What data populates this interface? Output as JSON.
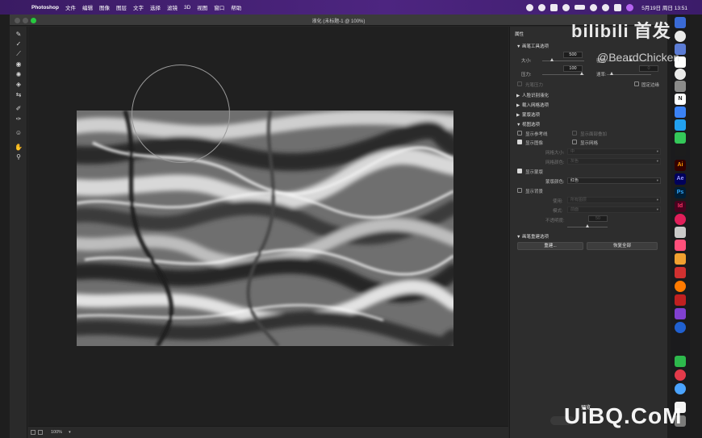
{
  "menubar": {
    "app_name": "Photoshop",
    "items": [
      "文件",
      "编辑",
      "图像",
      "图层",
      "文字",
      "选择",
      "滤镜",
      "3D",
      "视图",
      "窗口",
      "帮助"
    ],
    "datetime": "5月19日 周日 13:51"
  },
  "window": {
    "title": "液化 (未标题-1 @ 100%)"
  },
  "status": {
    "zoom": "100%"
  },
  "panel": {
    "title": "属性",
    "brush_section": "画笔工具选项",
    "size_label": "大小:",
    "size_value": "500",
    "density_label": "密度:",
    "pressure_label": "压力:",
    "pressure_value": "100",
    "rate_label": "速率:",
    "rate_value": "0",
    "stylus_label": "光笔压力",
    "pin_edges_label": "固定边缘",
    "face_aware": "人脸识别液化",
    "load_mesh": "载入网格选项",
    "mask_options": "蒙版选项",
    "view_options": "视图选项",
    "show_guides": "显示参考线",
    "show_face_overlay": "显示面部叠加",
    "show_image": "显示图像",
    "show_mesh": "显示网格",
    "mesh_size_label": "网格大小:",
    "mesh_size_value": "中",
    "mesh_color_label": "网格颜色:",
    "mesh_color_value": "灰色",
    "show_mask": "显示蒙版",
    "mask_color_label": "蒙版颜色:",
    "mask_color_value": "红色",
    "show_backdrop": "显示背景",
    "use_label": "使用:",
    "use_value": "所有图层",
    "mode_label": "模式:",
    "mode_value": "前面",
    "opacity_label": "不透明度:",
    "opacity_value": "50",
    "reconstruct_section": "画笔重建选项",
    "reconstruct_button": "重建...",
    "restore_all_button": "恢复全部"
  },
  "watermarks": {
    "bilibili": "bilibili",
    "bilibili_cn": "首发",
    "author": "@BeardChicken",
    "uibq": "UiBQ.CoM",
    "preview": "预览"
  },
  "dock": {
    "ai": "Ai",
    "ae": "Ae",
    "ps": "Ps",
    "id": "Id",
    "n": "N"
  }
}
